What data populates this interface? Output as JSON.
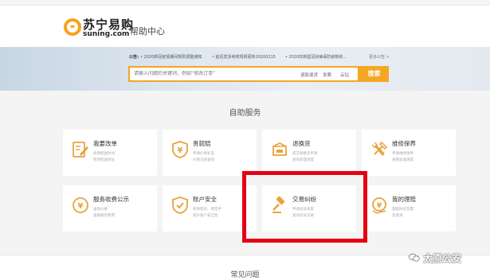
{
  "topbar": {
    "links": [
      "",
      "",
      "",
      ""
    ]
  },
  "header": {
    "logo_cn": "苏宁易购",
    "logo_en": "suning.com",
    "title": "帮助中心"
  },
  "notice": {
    "label": "公告:",
    "items": [
      "• 2020新冠疫情期间规则调整通知",
      "• 延迟发货考核规则更新20200215",
      "• 2020年新型冠状病毒防疫物资..."
    ],
    "more": "更多公告 >"
  },
  "search": {
    "placeholder": "请输入问题的关键词，例如“修改订单”",
    "tags": [
      "退款退货",
      "发票",
      "云钻"
    ],
    "button": "搜索"
  },
  "self_service": {
    "title": "自助服务",
    "cards": [
      {
        "name": "我要改单",
        "desc1": "修改配送时间",
        "desc2": "修改配送地址",
        "icon": "edit-order-icon"
      },
      {
        "name": "贵就赔",
        "desc1": "申请价保补差",
        "desc2": "价保记录查询",
        "icon": "price-protect-icon"
      },
      {
        "name": "退换货",
        "desc1": "提交退换货申请",
        "desc2": "查询处理进度",
        "icon": "return-box-icon"
      },
      {
        "name": "维修保养",
        "desc1": "申请维修保养",
        "desc2": "查看处理进度",
        "icon": "repair-tools-icon"
      },
      {
        "name": "服务收费公示",
        "desc1": "查询价格",
        "desc2": "查看服务费用",
        "icon": "service-fee-icon"
      },
      {
        "name": "账户安全",
        "desc1": "修改密码、绑定手",
        "desc2": "提升账户安全性",
        "icon": "account-shield-icon"
      },
      {
        "name": "交易纠纷",
        "desc1": "申请投诉商家",
        "desc2": "查询投诉记录",
        "icon": "dispute-hammer-icon"
      },
      {
        "name": "我的理赔",
        "desc1": "理赔协议签署",
        "desc2": "及查询",
        "icon": "claim-money-icon"
      }
    ]
  },
  "faq": {
    "title": "常见问题"
  },
  "watermark": {
    "text": "太原公安"
  },
  "colors": {
    "accent": "#f5a623",
    "icon": "#e8a33d",
    "highlight": "#e60012"
  }
}
